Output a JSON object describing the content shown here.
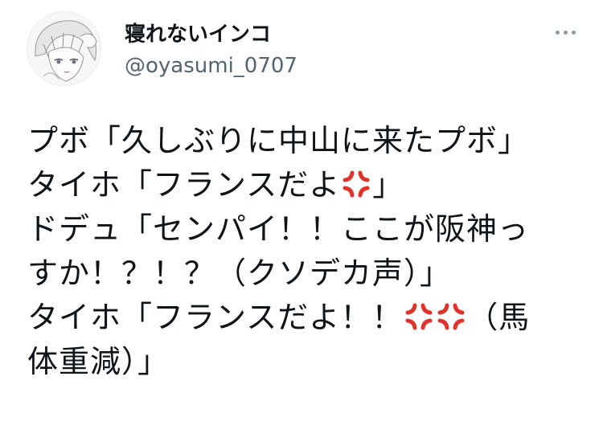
{
  "author": {
    "display_name": "寝れないインコ",
    "handle": "@oyasumi_0707"
  },
  "tweet": {
    "lines": [
      {
        "text_before": "プボ「久しぶりに中山に来たプボ」",
        "anger_count": 0,
        "text_after": ""
      },
      {
        "text_before": "タイホ「フランスだよ",
        "anger_count": 1,
        "text_after": "」"
      },
      {
        "text_before": "ドデュ「センパイ！！ここが阪神っ",
        "anger_count": 0,
        "text_after": ""
      },
      {
        "text_before": "すか！？！？（クソデカ声）」",
        "anger_count": 0,
        "text_after": ""
      },
      {
        "text_before": "タイホ「フランスだよ！！",
        "anger_count": 2,
        "text_after": "（馬"
      },
      {
        "text_before": "体重減）」",
        "anger_count": 0,
        "text_after": ""
      }
    ]
  },
  "icons": {
    "more": "more-horizontal-icon",
    "anger": "anger-symbol-emoji"
  },
  "colors": {
    "text": "#0f1419",
    "secondary_text": "#536471",
    "anger_emoji": "#e0332b"
  }
}
